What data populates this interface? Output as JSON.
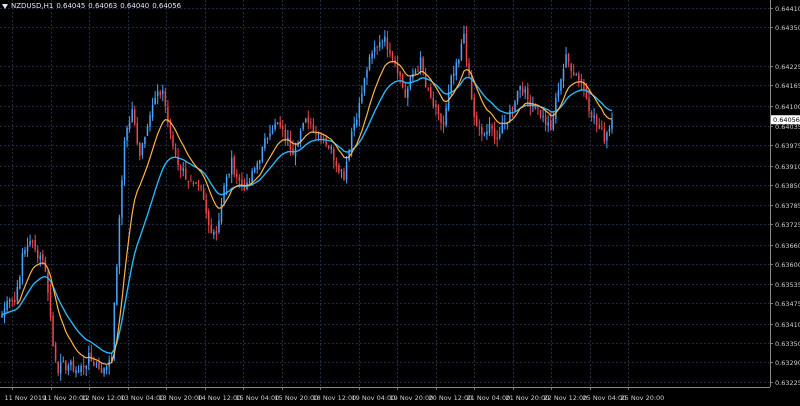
{
  "header": {
    "symbol_tf": "NZDUSD,H1",
    "ohlc": [
      "0.64045",
      "0.64063",
      "0.64040",
      "0.64056"
    ]
  },
  "chart_data": {
    "type": "candlestick",
    "symbol": "NZDUSD",
    "timeframe": "H1",
    "ylim": [
      0.6321,
      0.64435
    ],
    "y_ticks": [
      "0.64410",
      "0.64350",
      "0.64225",
      "0.64165",
      "0.64100",
      "0.64035",
      "0.63975",
      "0.63910",
      "0.63850",
      "0.63785",
      "0.63725",
      "0.63660",
      "0.63600",
      "0.63535",
      "0.63475",
      "0.63410",
      "0.63350",
      "0.63290",
      "0.63225"
    ],
    "x_ticks": [
      "11 Nov 2019",
      "11 Nov 20:00",
      "12 Nov 12:00",
      "13 Nov 04:00",
      "13 Nov 20:00",
      "14 Nov 12:00",
      "15 Nov 04:00",
      "15 Nov 20:00",
      "18 Nov 12:00",
      "19 Nov 04:00",
      "19 Nov 20:00",
      "20 Nov 12:00",
      "21 Nov 04:00",
      "21 Nov 20:00",
      "22 Nov 12:00",
      "25 Nov 04:00",
      "25 Nov 20:00"
    ],
    "current_price": "0.64056",
    "grid": true,
    "colors": {
      "bull": "#4aa3ff",
      "bear": "#e8474c",
      "ma_fast": "#ffb347",
      "ma_slow": "#29b6f6",
      "grid": "#1c2c48",
      "axis_text": "#cfcfcf",
      "price_tag_bg": "#ffffff",
      "price_tag_text": "#000000"
    },
    "keypoints": [
      [
        0,
        0.6344
      ],
      [
        3,
        0.635
      ],
      [
        5,
        0.6348
      ],
      [
        8,
        0.6362
      ],
      [
        11,
        0.6368
      ],
      [
        13,
        0.6364
      ],
      [
        16,
        0.6362
      ],
      [
        18,
        0.6352
      ],
      [
        20,
        0.6334
      ],
      [
        22,
        0.6327
      ],
      [
        26,
        0.6328
      ],
      [
        30,
        0.6326
      ],
      [
        34,
        0.633
      ],
      [
        37,
        0.6328
      ],
      [
        40,
        0.6326
      ],
      [
        43,
        0.6332
      ],
      [
        45,
        0.636
      ],
      [
        48,
        0.64
      ],
      [
        51,
        0.6408
      ],
      [
        54,
        0.6395
      ],
      [
        57,
        0.6405
      ],
      [
        60,
        0.6412
      ],
      [
        63,
        0.6415
      ],
      [
        66,
        0.64
      ],
      [
        69,
        0.6392
      ],
      [
        72,
        0.6388
      ],
      [
        75,
        0.6384
      ],
      [
        78,
        0.6383
      ],
      [
        81,
        0.6372
      ],
      [
        84,
        0.637
      ],
      [
        87,
        0.6384
      ],
      [
        90,
        0.6392
      ],
      [
        93,
        0.6386
      ],
      [
        96,
        0.6384
      ],
      [
        99,
        0.639
      ],
      [
        102,
        0.6396
      ],
      [
        105,
        0.6403
      ],
      [
        108,
        0.6404
      ],
      [
        111,
        0.64
      ],
      [
        114,
        0.6396
      ],
      [
        117,
        0.6402
      ],
      [
        120,
        0.6406
      ],
      [
        123,
        0.6402
      ],
      [
        126,
        0.64
      ],
      [
        129,
        0.6396
      ],
      [
        131,
        0.6392
      ],
      [
        134,
        0.6388
      ],
      [
        137,
        0.6402
      ],
      [
        140,
        0.641
      ],
      [
        143,
        0.6422
      ],
      [
        146,
        0.6428
      ],
      [
        149,
        0.6432
      ],
      [
        152,
        0.6428
      ],
      [
        155,
        0.6422
      ],
      [
        158,
        0.6413
      ],
      [
        161,
        0.642
      ],
      [
        164,
        0.6424
      ],
      [
        166,
        0.6416
      ],
      [
        169,
        0.641
      ],
      [
        171,
        0.6406
      ],
      [
        173,
        0.6404
      ],
      [
        176,
        0.6418
      ],
      [
        179,
        0.6424
      ],
      [
        181,
        0.6433
      ],
      [
        183,
        0.6418
      ],
      [
        185,
        0.6406
      ],
      [
        188,
        0.64
      ],
      [
        191,
        0.6403
      ],
      [
        194,
        0.64
      ],
      [
        197,
        0.6404
      ],
      [
        200,
        0.641
      ],
      [
        203,
        0.6417
      ],
      [
        206,
        0.6412
      ],
      [
        209,
        0.641
      ],
      [
        212,
        0.6406
      ],
      [
        215,
        0.6402
      ],
      [
        218,
        0.6416
      ],
      [
        221,
        0.6425
      ],
      [
        224,
        0.6421
      ],
      [
        227,
        0.6418
      ],
      [
        230,
        0.641
      ],
      [
        233,
        0.6404
      ],
      [
        236,
        0.64
      ],
      [
        239,
        0.64056
      ]
    ],
    "ma_fast_period": 12,
    "ma_slow_period": 24
  }
}
